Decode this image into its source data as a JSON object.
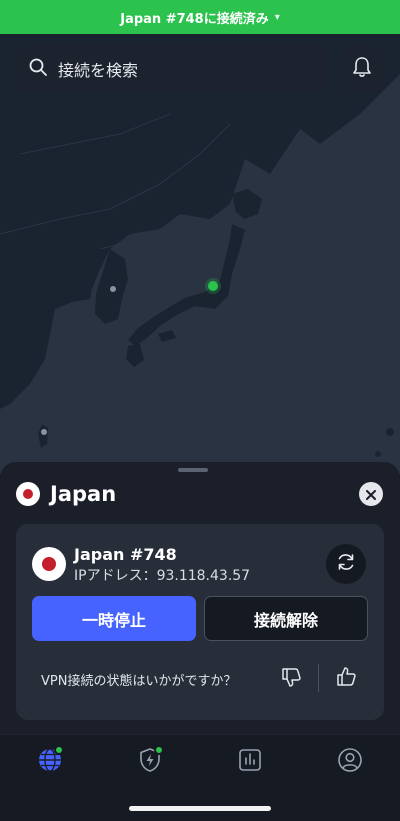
{
  "status_bar": {
    "title": "Japan #748に接続済み"
  },
  "search": {
    "placeholder": "接続を検索"
  },
  "sheet": {
    "country": "Japan",
    "server": {
      "name": "Japan #748",
      "ip": "IPアドレス：93.118.43.57"
    },
    "buttons": {
      "pause": "一時停止",
      "disconnect": "接続解除"
    },
    "feedback": {
      "question": "VPN接続の状態はいかがですか？"
    }
  },
  "tabs": [
    {
      "icon": "globe-icon",
      "active": true,
      "badge": true
    },
    {
      "icon": "shield-bolt-icon",
      "active": false,
      "badge": true
    },
    {
      "icon": "stats-icon",
      "active": false,
      "badge": false
    },
    {
      "icon": "profile-icon",
      "active": false,
      "badge": false
    }
  ],
  "colors": {
    "connected": "#2bc24d",
    "accent": "#4662ff",
    "map_land": "#1a2330",
    "map_water": "#293342"
  }
}
